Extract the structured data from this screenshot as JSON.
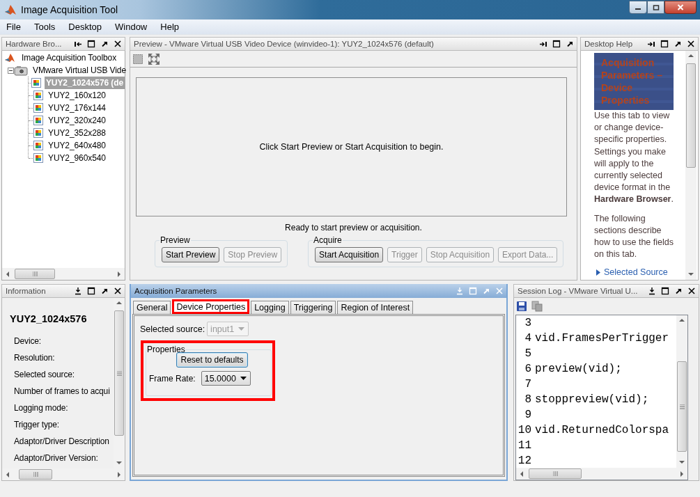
{
  "window": {
    "title": "Image Acquisition Tool"
  },
  "menu": [
    "File",
    "Tools",
    "Desktop",
    "Window",
    "Help"
  ],
  "hardware_browser": {
    "title": "Hardware Bro...",
    "active": false,
    "closable": true,
    "tree": {
      "label": "Image Acquisition Toolbox",
      "selected": false,
      "children": [
        {
          "label": "VMware Virtual USB Vide",
          "selected": false,
          "expanded": true,
          "children": [
            {
              "label": "YUY2_1024x576 (de",
              "selected": true
            },
            {
              "label": "YUY2_160x120",
              "selected": false
            },
            {
              "label": "YUY2_176x144",
              "selected": false
            },
            {
              "label": "YUY2_320x240",
              "selected": false
            },
            {
              "label": "YUY2_352x288",
              "selected": false
            },
            {
              "label": "YUY2_640x480",
              "selected": false
            },
            {
              "label": "YUY2_960x540",
              "selected": false
            }
          ]
        }
      ]
    }
  },
  "preview": {
    "title": "Preview - VMware Virtual USB Video Device (winvideo-1): YUY2_1024x576 (default)",
    "active": false,
    "closable": false,
    "message": "Click Start Preview or Start Acquisition to begin.",
    "status": "Ready to start preview or acquisition.",
    "groups": [
      {
        "title": "Preview",
        "buttons": [
          {
            "label": "Start Preview",
            "disabled": false
          },
          {
            "label": "Stop Preview",
            "disabled": true
          }
        ]
      },
      {
        "title": "Acquire",
        "buttons": [
          {
            "label": "Start Acquisition",
            "disabled": false
          },
          {
            "label": "Trigger",
            "disabled": true
          },
          {
            "label": "Stop Acquisition",
            "disabled": true
          },
          {
            "label": "Export Data...",
            "disabled": true
          }
        ]
      }
    ]
  },
  "desktop_help": {
    "title": "Desktop Help",
    "active": false,
    "closable": true,
    "heading": "Acquisition Parameters – Device Properties",
    "paragraphs": [
      "Use this tab to view or change device-specific properties. Settings you make will apply to the currently selected device format in the **Hardware Browser**.",
      "The following sections describe how to use the fields on this tab."
    ],
    "link": "Selected Source"
  },
  "information": {
    "title": "Information",
    "active": false,
    "closable": true,
    "heading": "YUY2_1024x576",
    "fields": [
      "Device:",
      "Resolution:",
      "Selected source:",
      "Number of frames to acqui",
      "Logging mode:",
      "Trigger type:",
      "Adaptor/Driver Description",
      "Adaptor/Driver Version:"
    ]
  },
  "acquisition_parameters": {
    "title": "Acquisition Parameters",
    "active": true,
    "closable": true,
    "tabs": [
      {
        "label": "General",
        "selected": false,
        "highlighted": false
      },
      {
        "label": "Device Properties",
        "selected": true,
        "highlighted": true
      },
      {
        "label": "Logging",
        "selected": false,
        "highlighted": false
      },
      {
        "label": "Triggering",
        "selected": false,
        "highlighted": false
      },
      {
        "label": "Region of Interest",
        "selected": false,
        "highlighted": false
      }
    ],
    "selected_source": {
      "label": "Selected source:",
      "value": "input1",
      "disabled": true
    },
    "properties": {
      "title": "Properties",
      "highlighted": true,
      "reset_button": "Reset to defaults",
      "frame_rate": {
        "label": "Frame Rate:",
        "value": "15.0000"
      }
    }
  },
  "session_log": {
    "title": "Session Log - VMware Virtual U...",
    "active": false,
    "closable": true,
    "lines": [
      {
        "number": "3"
      },
      {
        "number": "4",
        "code": "vid.FramesPerTrigger"
      },
      {
        "number": "5"
      },
      {
        "number": "6",
        "code": "preview(vid);"
      },
      {
        "number": "7"
      },
      {
        "number": "8",
        "code": "stoppreview(vid);"
      },
      {
        "number": "9"
      },
      {
        "number": "10",
        "code": "vid.ReturnedColorspa"
      },
      {
        "number": "11"
      },
      {
        "number": "12"
      }
    ]
  }
}
